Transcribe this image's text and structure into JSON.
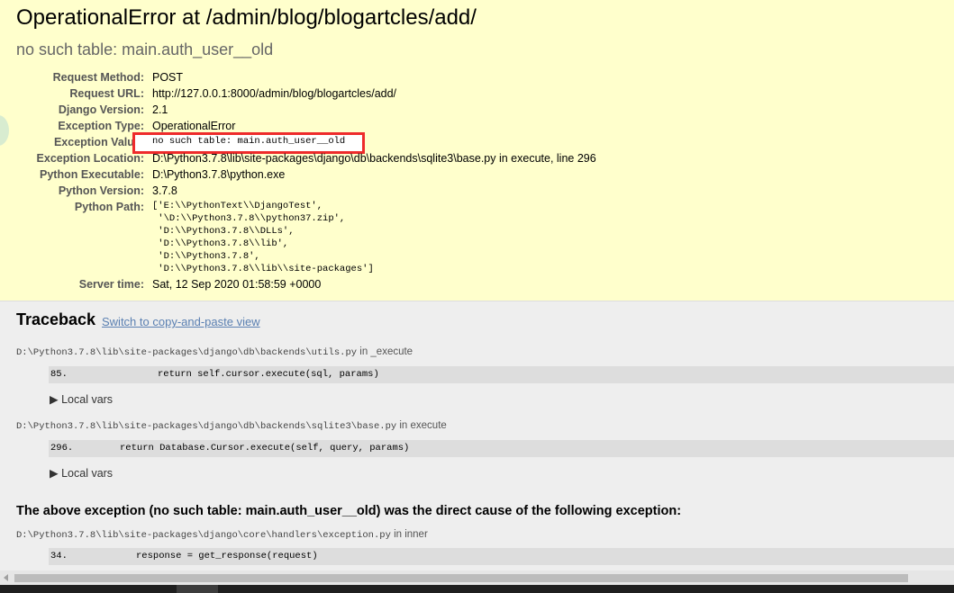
{
  "header": {
    "title": "OperationalError at /admin/blog/blogartcles/add/",
    "subtitle": "no such table: main.auth_user__old"
  },
  "meta": [
    {
      "label": "Request Method:",
      "value": "POST"
    },
    {
      "label": "Request URL:",
      "value": "http://127.0.0.1:8000/admin/blog/blogartcles/add/"
    },
    {
      "label": "Django Version:",
      "value": "2.1"
    },
    {
      "label": "Exception Type:",
      "value": "OperationalError"
    },
    {
      "label": "Exception Value:",
      "value": "no such table: main.auth_user__old"
    },
    {
      "label": "Exception Location:",
      "value": "D:\\Python3.7.8\\lib\\site-packages\\django\\db\\backends\\sqlite3\\base.py in execute, line 296"
    },
    {
      "label": "Python Executable:",
      "value": "D:\\Python3.7.8\\python.exe"
    },
    {
      "label": "Python Version:",
      "value": "3.7.8"
    },
    {
      "label": "Python Path:",
      "value": "['E:\\\\PythonText\\\\DjangoTest',\n '\\D:\\\\Python3.7.8\\\\python37.zip',\n 'D:\\\\Python3.7.8\\\\DLLs',\n 'D:\\\\Python3.7.8\\\\lib',\n 'D:\\\\Python3.7.8',\n 'D:\\\\Python3.7.8\\\\lib\\\\site-packages']"
    },
    {
      "label": "Server time:",
      "value": "Sat, 12 Sep 2020 01:58:59 +0000"
    }
  ],
  "traceback": {
    "title": "Traceback",
    "switch_link": "Switch to copy-and-paste view",
    "frames": [
      {
        "file": "D:\\Python3.7.8\\lib\\site-packages\\django\\db\\backends\\utils.py",
        "in": " in _execute",
        "lineno": "85.",
        "code": "return self.cursor.execute(sql, params)",
        "local_vars": "▶ Local vars"
      },
      {
        "file": "D:\\Python3.7.8\\lib\\site-packages\\django\\db\\backends\\sqlite3\\base.py",
        "in": " in execute",
        "lineno": "296.",
        "code": "return Database.Cursor.execute(self, query, params)",
        "local_vars": "▶ Local vars"
      },
      {
        "file": "D:\\Python3.7.8\\lib\\site-packages\\django\\core\\handlers\\exception.py",
        "in": " in inner",
        "lineno": "34.",
        "code": "response = get_response(request)"
      }
    ],
    "cause": "The above exception (no such table: main.auth_user__old) was the direct cause of the following exception:"
  },
  "colors": {
    "summary_bg": "#ffffcc",
    "highlight_border": "#ee2b2b",
    "link": "#5b80b2"
  }
}
